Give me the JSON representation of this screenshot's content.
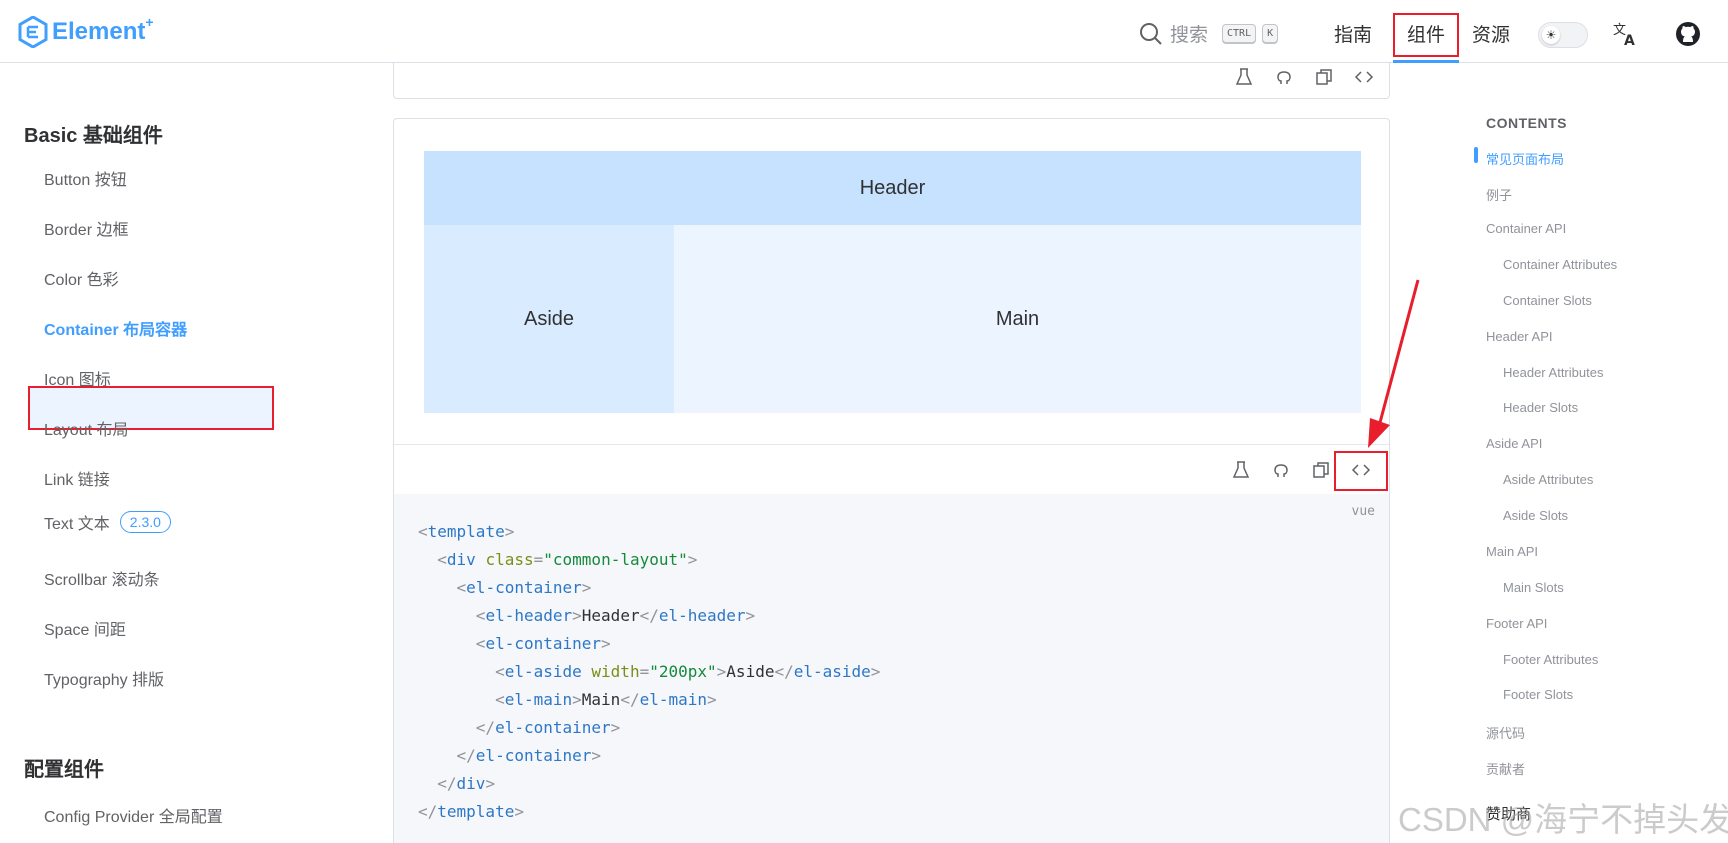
{
  "brand": {
    "name": "Element",
    "sup": "+"
  },
  "navbar": {
    "search_label": "搜索",
    "kbd": [
      "CTRL",
      "K"
    ],
    "links": [
      "指南",
      "组件",
      "资源"
    ],
    "active_link": "组件"
  },
  "sidebar": {
    "groups": [
      {
        "title": "Basic 基础组件",
        "items": [
          "Button 按钮",
          "Border 边框",
          "Color 色彩",
          "Container 布局容器",
          "Icon 图标",
          "Layout 布局",
          "Link 链接",
          "Text 文本",
          "Scrollbar 滚动条",
          "Space 间距",
          "Typography 排版"
        ],
        "active": "Container 布局容器",
        "text_badge": "2.3.0"
      },
      {
        "title": "配置组件",
        "items": [
          "Config Provider 全局配置"
        ]
      }
    ]
  },
  "demo": {
    "header": "Header",
    "aside": "Aside",
    "main": "Main",
    "code_lang": "vue",
    "op_icons": [
      "playground-icon",
      "github-icon",
      "copy-icon",
      "code-icon"
    ]
  },
  "toc": {
    "title": "CONTENTS",
    "items": [
      "常见页面布局",
      "例子",
      "Container API",
      "Container Attributes",
      "Container Slots",
      "Header API",
      "Header Attributes",
      "Header Slots",
      "Aside API",
      "Aside Attributes",
      "Aside Slots",
      "Main API",
      "Main Slots",
      "Footer API",
      "Footer Attributes",
      "Footer Slots",
      "源代码",
      "贡献者",
      "赞助商"
    ],
    "active": "常见页面布局"
  },
  "watermark": "CSDN @海宁不掉头发",
  "colors": {
    "accent": "#409eff",
    "highlight_box": "#e81e2c",
    "header_bg": "#c6e2ff",
    "aside_bg": "#d9ecff",
    "main_bg": "#ecf5ff"
  }
}
